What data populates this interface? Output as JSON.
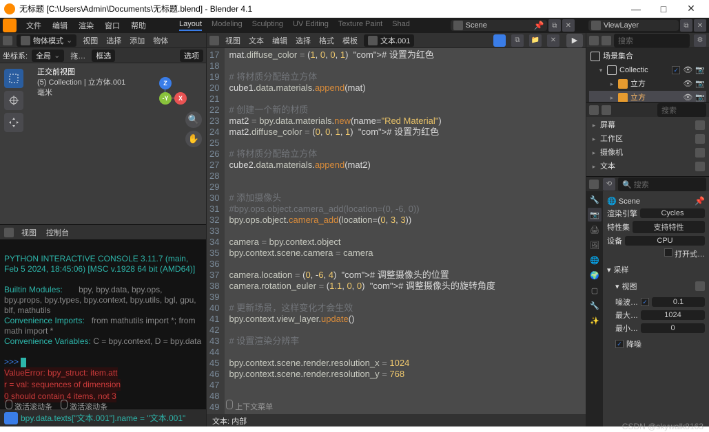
{
  "window": {
    "title": "无标题 [C:\\Users\\Admin\\Documents\\无标题.blend] - Blender 4.1"
  },
  "win_btns": {
    "min": "—",
    "max": "□",
    "close": "✕"
  },
  "menu": [
    "文件",
    "编辑",
    "渲染",
    "窗口",
    "帮助"
  ],
  "workspace_tabs": [
    "Layout",
    "Modeling",
    "Sculpting",
    "UV Editing",
    "Texture Paint",
    "Shad"
  ],
  "scene": {
    "label": "Scene"
  },
  "viewlayer": {
    "label": "ViewLayer"
  },
  "vp": {
    "mode": "物体模式",
    "menus": [
      "视图",
      "选择",
      "添加",
      "物体"
    ],
    "sub": {
      "coord": "坐标系:",
      "global": "全局",
      "drag": "拖…",
      "box": "框选",
      "opt": "选项"
    },
    "overlay": {
      "view": "正交前视图",
      "coll": "(5) Collection | 立方体.001",
      "unit": "毫米"
    }
  },
  "console_hd": {
    "view": "视图",
    "ctrl": "控制台"
  },
  "console": {
    "l1": "PYTHON INTERACTIVE CONSOLE 3.11.7 (main, Feb  5 2024, 18:45:06) [MSC v.1928 64 bit (AMD64)]",
    "l2a": "Builtin Modules:",
    "l2b": "bpy, bpy.data, bpy.ops, bpy.props, bpy.types, bpy.context, bpy.utils, bgl, gpu, blf, mathutils",
    "l3a": "Convenience Imports:",
    "l3b": "from mathutils import *; from math import *",
    "l4a": "Convenience Variables:",
    "l4b": "C = bpy.context, D = bpy.data",
    "prompt": ">>>",
    "err1": "ValueError: bpy_struct: item.att",
    "err2": "r = val: sequences of dimension",
    "err3": "0 should contain 4 items, not 3",
    "foot": "bpy.data.texts[\"文本.001\"].name = \"文本.001\""
  },
  "text": {
    "menus": [
      "视图",
      "文本",
      "编辑",
      "选择",
      "格式",
      "模板"
    ],
    "name": "文本.001",
    "footer": "文本: 内部"
  },
  "code_lines": [
    {
      "n": 17,
      "t": "mat.diffuse_color = (1, 0, 0, 1)  # 设置为红色"
    },
    {
      "n": 18,
      "t": ""
    },
    {
      "n": 19,
      "t": "# 将材质分配给立方体"
    },
    {
      "n": 20,
      "t": "cube1.data.materials.append(mat)"
    },
    {
      "n": 21,
      "t": ""
    },
    {
      "n": 22,
      "t": "# 创建一个新的材质"
    },
    {
      "n": 23,
      "t": "mat2 = bpy.data.materials.new(name=\"Red Material\")"
    },
    {
      "n": 24,
      "t": "mat2.diffuse_color = (0, 0, 1, 1)  # 设置为红色"
    },
    {
      "n": 25,
      "t": ""
    },
    {
      "n": 26,
      "t": "# 将材质分配给立方体"
    },
    {
      "n": 27,
      "t": "cube2.data.materials.append(mat2)"
    },
    {
      "n": 28,
      "t": ""
    },
    {
      "n": 29,
      "t": ""
    },
    {
      "n": 30,
      "t": "# 添加摄像头"
    },
    {
      "n": 31,
      "t": "#bpy.ops.object.camera_add(location=(0, -6, 0))"
    },
    {
      "n": 32,
      "t": "bpy.ops.object.camera_add(location=(0, 3, 3))"
    },
    {
      "n": 33,
      "t": ""
    },
    {
      "n": 34,
      "t": "camera = bpy.context.object"
    },
    {
      "n": 35,
      "t": "bpy.context.scene.camera = camera"
    },
    {
      "n": 36,
      "t": ""
    },
    {
      "n": 37,
      "t": "camera.location = (0, -6, 4)  # 调整摄像头的位置"
    },
    {
      "n": 38,
      "t": "camera.rotation_euler = (1.1, 0, 0)  # 调整摄像头的旋转角度"
    },
    {
      "n": 39,
      "t": ""
    },
    {
      "n": 40,
      "t": "# 更新场景，这样变化才会生效"
    },
    {
      "n": 41,
      "t": "bpy.context.view_layer.update()"
    },
    {
      "n": 42,
      "t": ""
    },
    {
      "n": 43,
      "t": "# 设置渲染分辨率"
    },
    {
      "n": 44,
      "t": ""
    },
    {
      "n": 45,
      "t": "bpy.context.scene.render.resolution_x = 1024"
    },
    {
      "n": 46,
      "t": "bpy.context.scene.render.resolution_y = 768"
    },
    {
      "n": 47,
      "t": ""
    },
    {
      "n": 48,
      "t": ""
    },
    {
      "n": 49,
      "t": ""
    }
  ],
  "outliner": {
    "search_ph": "搜索",
    "root": "场景集合",
    "coll": "Collectic",
    "cube1": "立方",
    "cube2": "立方"
  },
  "props_list": {
    "items": [
      "屏幕",
      "工作区",
      "摄像机",
      "文本"
    ]
  },
  "props": {
    "search_ph": "搜索",
    "scene": "Scene",
    "render": "渲染引擎",
    "render_v": "Cycles",
    "feat": "特性集",
    "feat_v": "支持特性",
    "dev": "设备",
    "dev_v": "CPU",
    "open": "打开式…",
    "sample": "采样",
    "view": "视图",
    "noise": "噪波…",
    "noise_v": "0.1",
    "max": "最大…",
    "max_v": "1024",
    "min": "最小…",
    "min_v": "0",
    "deno": "降噪"
  },
  "status": {
    "s1": "激活滚动条",
    "s2": "激活滚动条",
    "s3": "上下文菜单"
  },
  "watermark": "CSDN @skywalk8163"
}
